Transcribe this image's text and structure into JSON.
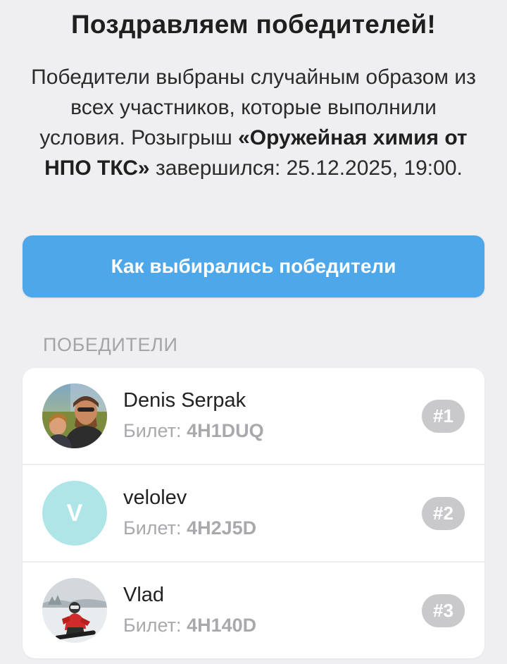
{
  "header": {
    "title": "Поздравляем победителей!",
    "description_before": "Победители выбраны случайным образом из всех участников, которые выполнили условия. Розыгрыш",
    "giveaway_name": "«Оружейная химия от НПО ТКС»",
    "description_after": "завершился: 25.12.2025, 19:00."
  },
  "how_button": {
    "label": "Как выбирались победители"
  },
  "winners_section": {
    "label": "ПОБЕДИТЕЛИ",
    "items": [
      {
        "name": "Denis Serpak",
        "ticket_label": "Билет:",
        "ticket_code": "4H1DUQ",
        "rank": "#1",
        "avatar": "photo-avatar"
      },
      {
        "name": "velolev",
        "ticket_label": "Билет:",
        "ticket_code": "4H2J5D",
        "rank": "#2",
        "avatar_letter": "V",
        "avatar_color": "#aee6e8"
      },
      {
        "name": "Vlad",
        "ticket_label": "Билет:",
        "ticket_code": "4H140D",
        "rank": "#3",
        "avatar": "photo-avatar"
      }
    ]
  },
  "colors": {
    "accent": "#4ea7e9",
    "background": "#efeff1",
    "rank_badge": "#c9c9cc"
  }
}
